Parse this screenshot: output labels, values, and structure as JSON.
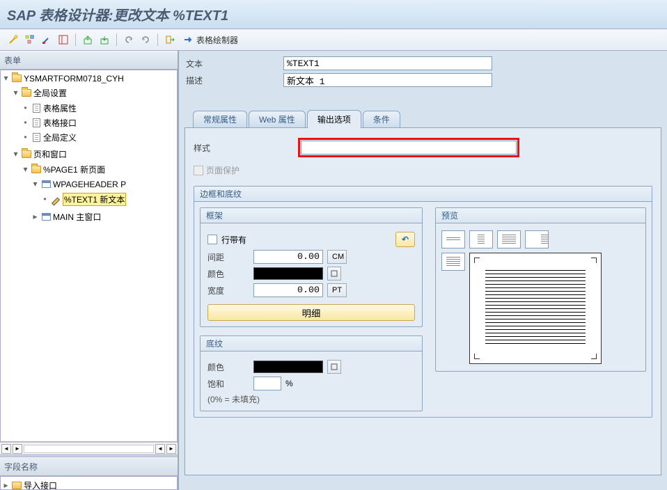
{
  "title": "SAP 表格设计器:更改文本 %TEXT1",
  "toolbar": {
    "form_painter": "表格绘制器"
  },
  "left": {
    "panel_form": "表单",
    "panel_fieldname": "字段名称",
    "tree": {
      "root": "YSMARTFORM0718_CYH",
      "global_settings": "全局设置",
      "form_attr": "表格属性",
      "form_intf": "表格接口",
      "global_def": "全局定义",
      "pages_windows": "页和窗口",
      "page1": "%PAGE1 新页面",
      "wpageheader": "WPAGEHEADER P",
      "text1": "%TEXT1 新文本",
      "main": "MAIN 主窗口",
      "import_intf": "导入接口"
    }
  },
  "props": {
    "text_label": "文本",
    "text_value": "%TEXT1",
    "desc_label": "描述",
    "desc_value": "新文本 1"
  },
  "tabs": {
    "general": "常规属性",
    "web": "Web 属性",
    "output": "输出选项",
    "cond": "条件"
  },
  "output": {
    "style_label": "样式",
    "style_value": "",
    "page_protect": "页面保护",
    "border_shading": "边框和底纹",
    "frame": "框架",
    "line_with": "行带有",
    "spacing": "间距",
    "spacing_val": "0.00",
    "spacing_unit": "CM",
    "color": "颜色",
    "width": "宽度",
    "width_val": "0.00",
    "width_unit": "PT",
    "detail": "明细",
    "shading": "底纹",
    "saturation": "饱和",
    "pct_unit": "%",
    "not_filled": "(0% = 未填充)",
    "preview": "预览"
  }
}
